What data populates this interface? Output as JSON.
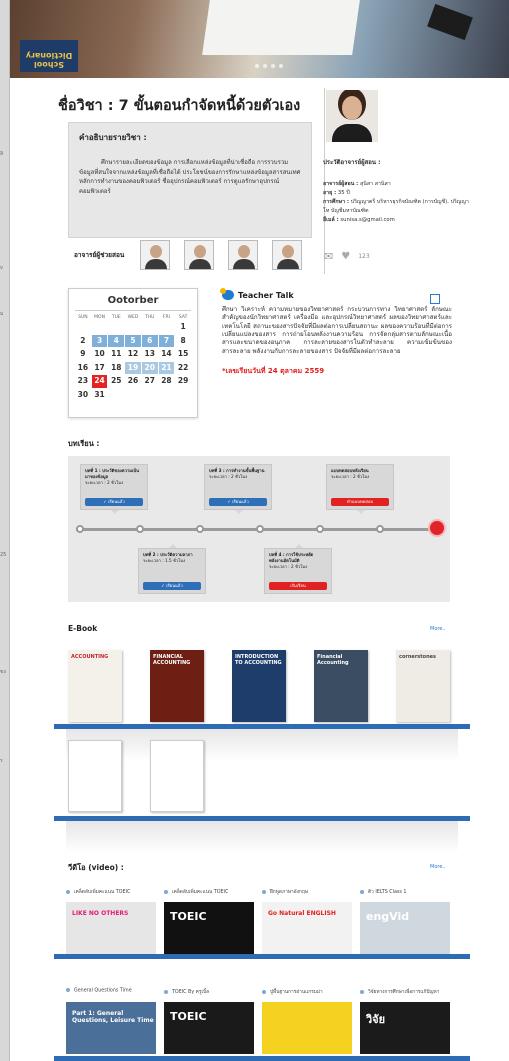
{
  "course": {
    "title": "ชื่อวิชา : 7 ขั้นตอนกำจัดหนี้ด้วยตัวเอง",
    "description_heading": "คำอธิบายรายวิชา :",
    "description": "ศึกษารายละเอียดของข้อมูล การเลือกแหล่งข้อมูลที่น่าเชื่อถือ การรวบรวมข้อมูลที่สนใจจากแหล่งข้อมูลที่เชื่อถือได้ ประโยชน์ของการรักษาแหล่งข้อมูลสารสนเทศ หลักการทำงานของคอมพิวเตอร์ ชื่ออุปกรณ์คอมพิวเตอร์ การดูแลรักษาอุปกรณ์คอมพิวเตอร์",
    "co_instructors_label": "อาจารย์ผู้ช่วยสอน"
  },
  "hero": {
    "book_text": "School Dictionary"
  },
  "instructor": {
    "heading": "ประวัติอาจารย์ผู้สอน :",
    "name_label": "อาจารย์ผู้สอน :",
    "name": "สุนิสา สานิสา",
    "age_label": "อายุ :",
    "age": "35 ปี",
    "education_label": "การศึกษา :",
    "education": "ปริญญาตรี บริหารธุรกิจบัณฑิต (การบัญชี), ปริญญาโท บัญชีมหาบัณฑิต",
    "email_label": "อีเมล์ :",
    "email": "sunisa.s@gmail.com",
    "likes": "123"
  },
  "calendar": {
    "month": "Ootorber",
    "weekdays": [
      "SUN",
      "MON",
      "TUE",
      "WED",
      "THU",
      "FRI",
      "SAT"
    ],
    "days": [
      "",
      "",
      "",
      "",
      "",
      "",
      "1",
      "2",
      "3",
      "4",
      "5",
      "6",
      "7",
      "8",
      "9",
      "10",
      "11",
      "12",
      "13",
      "14",
      "15",
      "16",
      "17",
      "18",
      "19",
      "20",
      "21",
      "22",
      "23",
      "24",
      "25",
      "26",
      "27",
      "28",
      "29",
      "30",
      "31"
    ]
  },
  "teacher_talk": {
    "title": "Teacher Talk",
    "body": "ศึกษา วิเคราะห์ ความหมายของวิทยาศาสตร์ กระบวนการทาง วิทยาศาสตร์ ลักษณะสำคัญของนักวิทยาศาสตร์ เครื่องมือ และอุปกรณ์วิทยาศาสตร์ ผลของวิทยาศาสตร์และเทคโนโลยี สถานะของสารปัจจัยที่มีผลต่อการเปลี่ยนสถานะ ผลของความร้อนที่มีต่อการเปลี่ยนแปลงของสาร การถ่ายโอนพลังงานความร้อน การจัดกลุ่มสารตามลักษณะเนื้อสารและขนาดของอนุภาค การละลายของสารในตัวทำละลาย ความเข้มข้นของสารละลาย พลังงานกับการละลายของสาร ปัจจัยที่มีผลต่อการละลาย",
    "date": "*เลขเรียนวันที่ 24 ตุลาคม 2559"
  },
  "lessons": {
    "heading": "บทเรียน :",
    "items": [
      {
        "title": "บทที่ 1 : ประวัติของความเป็นมาของข้อมูล",
        "duration": "ระยะเวลา : 2 ชั่วโมง",
        "button": "เรียนแล้ว"
      },
      {
        "title": "บทที่ 2 : ประวัติความลาภา",
        "duration": "ระยะเวลา : 1.5 ชั่วโมง",
        "button": "เรียนแล้ว"
      },
      {
        "title": "บทที่ 3 : การทำงานขั้นพื้นฐาน",
        "duration": "ระยะเวลา : 2 ชั่วโมง",
        "button": "เรียนแล้ว"
      },
      {
        "title": "บทที่ 4 : การใช้ประหยัดพลังงานอัตโนมัติ",
        "duration": "ระยะเวลา : 2 ชั่วโมง",
        "button": "เริ่มเรียน"
      },
      {
        "title": "แบบทดสอบหลังเรียน",
        "duration": "ระยะเวลา : 2 ชั่วโมง",
        "button": "ทำแบบทดสอบ"
      }
    ]
  },
  "ebook": {
    "heading": "E-Book",
    "more": "More..",
    "books": [
      {
        "title": "ACCOUNTING",
        "color": "#f4f1ea",
        "text_color": "#c2262e"
      },
      {
        "title": "FINANCIAL ACCOUNTING",
        "color": "#6e1f14",
        "text_color": "#ffffff"
      },
      {
        "title": "INTRODUCTION TO ACCOUNTING",
        "color": "#1f3d6b",
        "text_color": "#ffffff"
      },
      {
        "title": "Financial Accounting",
        "color": "#3b4d62",
        "text_color": "#ffffff"
      },
      {
        "title": "cornerstones",
        "color": "#efece6",
        "text_color": "#444444"
      },
      {
        "title": "",
        "color": "#ffffff",
        "text_color": "#2a6cc1"
      },
      {
        "title": "",
        "color": "#ffffff",
        "text_color": "#888888"
      }
    ]
  },
  "videos": {
    "heading": "วีดีโอ (video) :",
    "more": "More..",
    "items": [
      {
        "label": "เคล็ดลับเพิ่มคะแนน TOEIC",
        "thumb_text": "LIKE NO OTHERS",
        "bg": "#e6e6e6",
        "fg": "#e11b74"
      },
      {
        "label": "เคล็ดลับเพิ่มคะแนน TOEIC",
        "thumb_text": "TOEIC",
        "bg": "#111111",
        "fg": "#ffffff"
      },
      {
        "label": "ฝึกพูดภาษาอังกฤษ",
        "thumb_text": "Go Natural ENGLISH",
        "bg": "#f2f2f2",
        "fg": "#e02020"
      },
      {
        "label": "ติว IELTS Class 1",
        "thumb_text": "engVid",
        "bg": "#cfd8df",
        "fg": "#ffffff"
      },
      {
        "label": "General Questions Time",
        "thumb_text": "Part 1: General Questions, Leisure Time",
        "bg": "#4a6f98",
        "fg": "#ffffff"
      },
      {
        "label": "TOEIC By ครูเบิ้ล",
        "thumb_text": "TOEIC",
        "bg": "#1a1a1a",
        "fg": "#ffffff"
      },
      {
        "label": "ปูพื้นฐานการอ่านแกรมม่า",
        "thumb_text": "",
        "bg": "#f4d21f",
        "fg": "#222222"
      },
      {
        "label": "วิจัยทางการศึกษาเพื่อการแก้ปัญหา",
        "thumb_text": "วิจัย",
        "bg": "#1b1b1b",
        "fg": "#ffffff"
      }
    ]
  }
}
